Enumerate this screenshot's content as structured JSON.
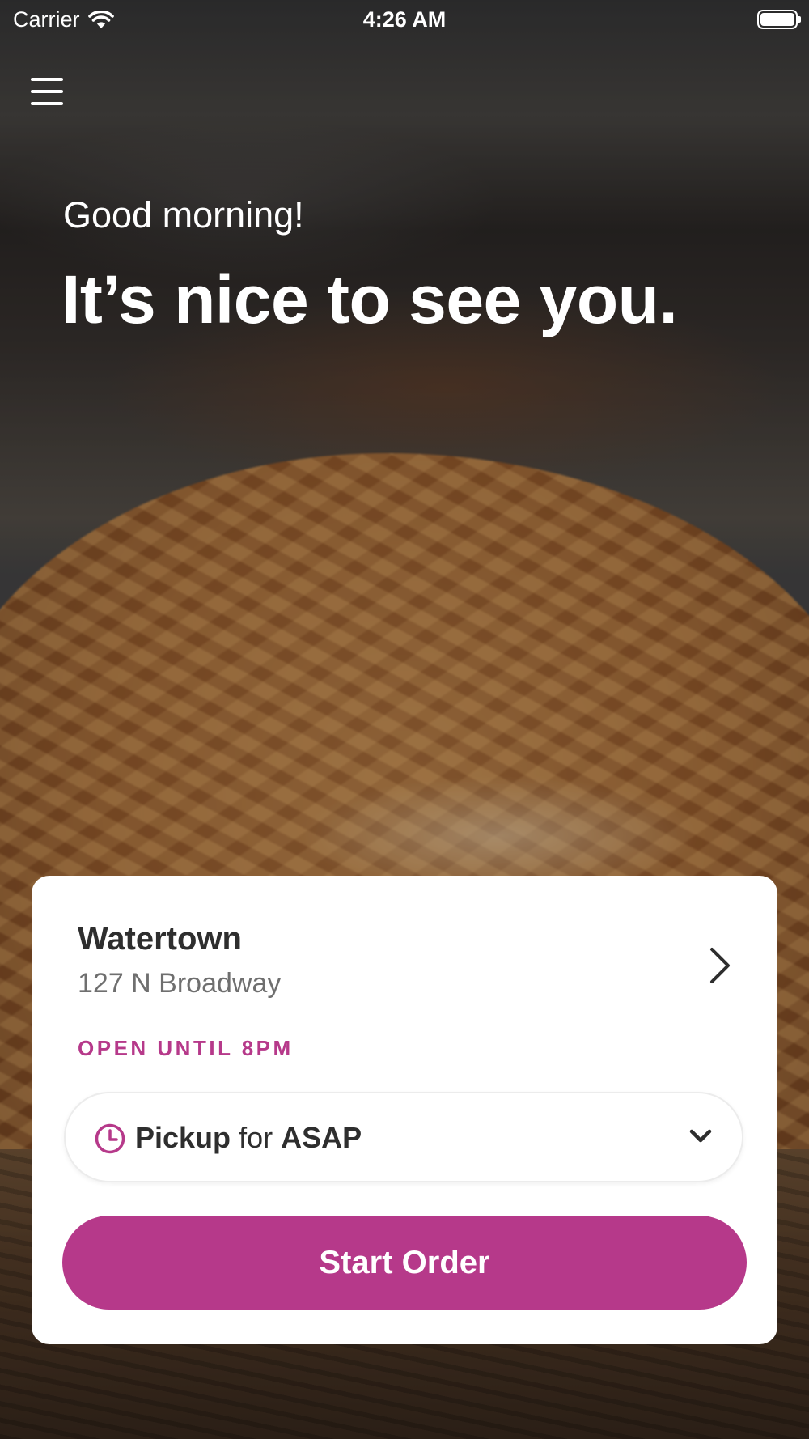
{
  "status_bar": {
    "carrier": "Carrier",
    "time": "4:26 AM"
  },
  "icons": {
    "menu": "hamburger-menu-icon",
    "wifi": "wifi-icon",
    "battery": "battery-icon",
    "chevron_right": "chevron-right-icon",
    "clock": "clock-icon",
    "chevron_down": "chevron-down-icon"
  },
  "greeting": {
    "subtitle": "Good morning!",
    "title": "It’s nice to see you."
  },
  "location": {
    "name": "Watertown",
    "address": "127 N Broadway",
    "hours": "OPEN UNTIL 8PM"
  },
  "order_mode": {
    "mode": "Pickup",
    "connector": "for",
    "time": "ASAP"
  },
  "actions": {
    "start_order": "Start Order"
  },
  "colors": {
    "accent": "#b6398a",
    "card_bg": "#ffffff",
    "text_primary": "#2e2e2e",
    "text_secondary": "#6f6f6f"
  }
}
